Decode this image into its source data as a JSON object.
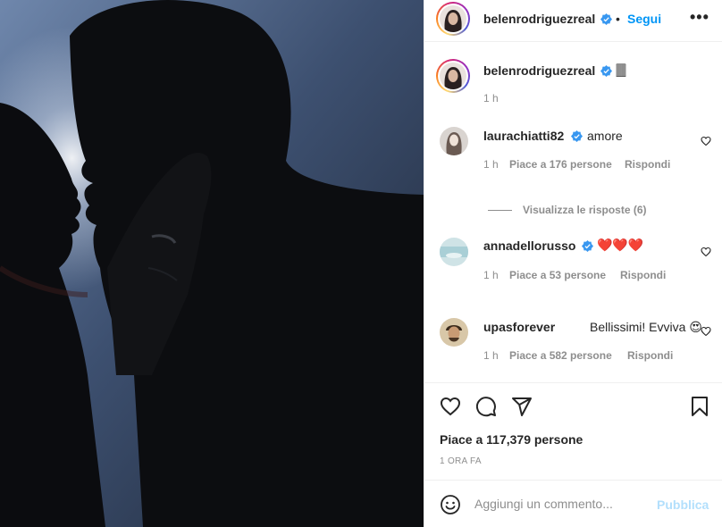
{
  "post": {
    "author": "belenrodriguezreal",
    "follow_label": "Segui",
    "separator": "•",
    "more_label": "•••"
  },
  "caption": {
    "username": "belenrodriguezreal",
    "text": "🀫",
    "time": "1 h"
  },
  "comments": [
    {
      "username": "laurachiatti82",
      "verified": true,
      "text": "amore",
      "time": "1 h",
      "likes": "Piace a 176 persone",
      "reply": "Rispondi",
      "view_replies": "Visualizza le risposte (6)"
    },
    {
      "username": "annadellorusso",
      "verified": true,
      "text": "❤️❤️❤️",
      "time": "1 h",
      "likes": "Piace a 53 persone",
      "reply": "Rispondi"
    },
    {
      "username": "upasforever",
      "verified": false,
      "text": "Bellissimi! Evviva 😍",
      "time": "1 h",
      "likes": "Piace a 582 persone",
      "reply": "Rispondi"
    }
  ],
  "actions": {
    "likes": "Piace a 117,379 persone",
    "posted": "1 ORA FA"
  },
  "add_comment": {
    "placeholder": "Aggiungi un commento...",
    "publish_label": "Pubblica"
  },
  "colors": {
    "accent": "#0095f6",
    "verified": "#3897f0",
    "publish_disabled": "#b2dffc"
  }
}
